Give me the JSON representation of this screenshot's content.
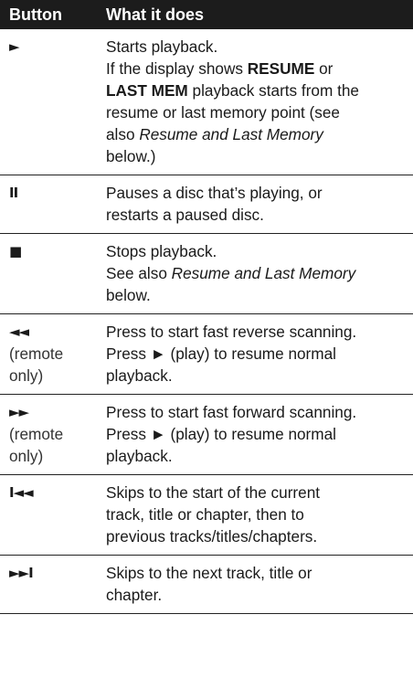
{
  "header": {
    "col1": "Button",
    "col2": "What it does"
  },
  "rows": [
    {
      "symbol": "►",
      "symbol_name": "play-icon",
      "lines": [
        [
          {
            "t": "Starts playback."
          }
        ],
        [
          {
            "t": "If the display shows "
          },
          {
            "t": "RESUME",
            "s": "b"
          },
          {
            "t": " or"
          }
        ],
        [
          {
            "t": "LAST MEM",
            "s": "b"
          },
          {
            "t": " playback starts from the"
          }
        ],
        [
          {
            "t": "resume or last memory point (see"
          }
        ],
        [
          {
            "t": "also "
          },
          {
            "t": "Resume and Last Memory",
            "s": "i"
          }
        ],
        [
          {
            "t": "below.)"
          }
        ]
      ]
    },
    {
      "symbol": "II",
      "symbol_name": "pause-icon",
      "lines": [
        [
          {
            "t": "Pauses a disc that’s playing, or"
          }
        ],
        [
          {
            "t": "restarts a paused disc."
          }
        ]
      ]
    },
    {
      "symbol": "■",
      "symbol_name": "stop-icon",
      "lines": [
        [
          {
            "t": "Stops playback."
          }
        ],
        [
          {
            "t": "See also "
          },
          {
            "t": "Resume and Last Memory",
            "s": "i"
          }
        ],
        [
          {
            "t": "below."
          }
        ]
      ]
    },
    {
      "symbol": "◄◄",
      "symbol_name": "fast-reverse-icon",
      "note": [
        "(remote",
        "only)"
      ],
      "lines": [
        [
          {
            "t": "Press to start fast reverse scanning."
          }
        ],
        [
          {
            "t": "Press ► (play) to resume normal"
          }
        ],
        [
          {
            "t": "playback."
          }
        ]
      ]
    },
    {
      "symbol": "►►",
      "symbol_name": "fast-forward-icon",
      "note": [
        "(remote",
        "only)"
      ],
      "lines": [
        [
          {
            "t": "Press to start fast forward scanning."
          }
        ],
        [
          {
            "t": "Press ► (play) to resume normal"
          }
        ],
        [
          {
            "t": "playback."
          }
        ]
      ]
    },
    {
      "symbol": "I◄◄",
      "symbol_name": "skip-previous-icon",
      "lines": [
        [
          {
            "t": "Skips to the start of the current"
          }
        ],
        [
          {
            "t": "track, title or chapter, then to"
          }
        ],
        [
          {
            "t": "previous tracks/titles/chapters."
          }
        ]
      ]
    },
    {
      "symbol": "►►I",
      "symbol_name": "skip-next-icon",
      "lines": [
        [
          {
            "t": "Skips to the next track, title or"
          }
        ],
        [
          {
            "t": "chapter."
          }
        ]
      ]
    }
  ]
}
